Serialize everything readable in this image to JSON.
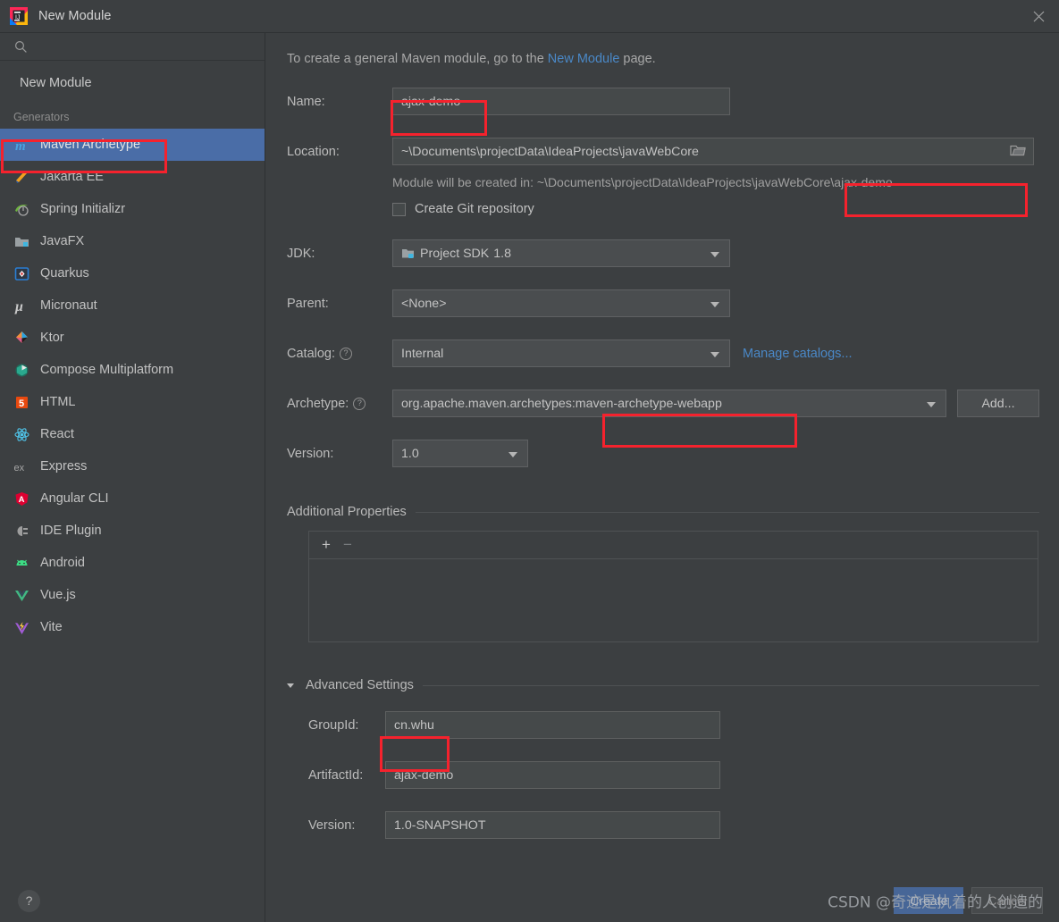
{
  "window": {
    "title": "New Module",
    "app_icon": "intellij-idea-logo",
    "close_icon": "close-icon"
  },
  "sidebar": {
    "search_placeholder": "",
    "search_icon": "search-icon",
    "heading": "New Module",
    "group_label": "Generators",
    "selected": "Maven Archetype",
    "items": [
      {
        "label": "Maven Archetype",
        "icon": "maven-icon",
        "selected": true
      },
      {
        "label": "Jakarta EE",
        "icon": "jakarta-ee-icon",
        "selected": false
      },
      {
        "label": "Spring Initializr",
        "icon": "spring-icon",
        "selected": false
      },
      {
        "label": "JavaFX",
        "icon": "javafx-icon",
        "selected": false
      },
      {
        "label": "Quarkus",
        "icon": "quarkus-icon",
        "selected": false
      },
      {
        "label": "Micronaut",
        "icon": "micronaut-icon",
        "selected": false
      },
      {
        "label": "Ktor",
        "icon": "ktor-icon",
        "selected": false
      },
      {
        "label": "Compose Multiplatform",
        "icon": "compose-icon",
        "selected": false
      },
      {
        "label": "HTML",
        "icon": "html5-icon",
        "selected": false
      },
      {
        "label": "React",
        "icon": "react-icon",
        "selected": false
      },
      {
        "label": "Express",
        "icon": "express-icon",
        "selected": false
      },
      {
        "label": "Angular CLI",
        "icon": "angular-icon",
        "selected": false
      },
      {
        "label": "IDE Plugin",
        "icon": "plugin-icon",
        "selected": false
      },
      {
        "label": "Android",
        "icon": "android-icon",
        "selected": false
      },
      {
        "label": "Vue.js",
        "icon": "vue-icon",
        "selected": false
      },
      {
        "label": "Vite",
        "icon": "vite-icon",
        "selected": false
      }
    ],
    "help_button": "?"
  },
  "main": {
    "hint_prefix": "To create a general Maven module, go to the ",
    "hint_link": "New Module",
    "hint_suffix": " page.",
    "name": {
      "label": "Name:",
      "value": "ajax-demo"
    },
    "location": {
      "label": "Location:",
      "value": "~\\Documents\\projectData\\IdeaProjects\\javaWebCore",
      "browse_icon": "folder-icon",
      "note_prefix": "Module will be created in: ",
      "note_path": "~\\Documents\\projectData\\IdeaProjects\\javaWebCore\\ajax-demo"
    },
    "git": {
      "label": "Create Git repository",
      "checked": false
    },
    "jdk": {
      "label": "JDK:",
      "value": "Project SDK",
      "value_dim": "1.8",
      "icon": "sdk-icon"
    },
    "parent": {
      "label": "Parent:",
      "value": "<None>"
    },
    "catalog": {
      "label": "Catalog:",
      "help_icon": "help-circle-icon",
      "value": "Internal",
      "manage_link": "Manage catalogs..."
    },
    "archetype": {
      "label": "Archetype:",
      "help_icon": "help-circle-icon",
      "value_prefix": "org.apache.maven.archetypes",
      "value_highlight": ":maven-archetype-webapp",
      "add_button": "Add..."
    },
    "version": {
      "label": "Version:",
      "value": "1.0"
    },
    "additional_properties": {
      "title": "Additional Properties",
      "add_icon": "plus-icon",
      "remove_icon": "minus-icon"
    },
    "advanced": {
      "title": "Advanced Settings",
      "expanded": true,
      "chevron_icon": "chevron-down-icon",
      "group_id": {
        "label": "GroupId:",
        "value": "cn.whu"
      },
      "artifact_id": {
        "label": "ArtifactId:",
        "value": "ajax-demo"
      },
      "version": {
        "label": "Version:",
        "value": "1.0-SNAPSHOT"
      }
    }
  },
  "footer": {
    "cancel_label": "Cancel",
    "create_label": "Create",
    "watermark": "CSDN @奇迹是执着的人创造的"
  },
  "colors": {
    "background": "#3c3f41",
    "field": "#45494a",
    "accent_selection": "#4a6da7",
    "link": "#4a88c7",
    "annotation_red": "#f5222d",
    "text": "#c2c2c2",
    "text_dim": "#8e8e8e"
  }
}
